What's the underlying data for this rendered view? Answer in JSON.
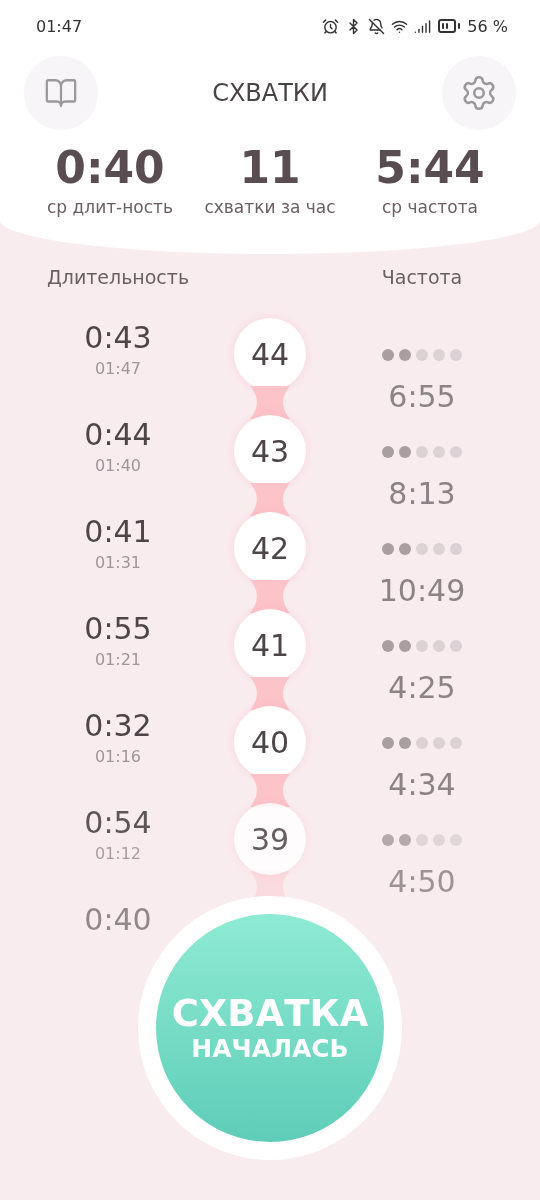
{
  "status_bar": {
    "time": "01:47",
    "battery": "56 %"
  },
  "header": {
    "title": "СХВАТКИ"
  },
  "stats": [
    {
      "value": "0:40",
      "label": "ср длит-ность"
    },
    {
      "value": "11",
      "label": "схватки за час"
    },
    {
      "value": "5:44",
      "label": "ср частота"
    }
  ],
  "columns": {
    "duration": "Длительность",
    "frequency": "Частота"
  },
  "contractions": [
    {
      "duration": "0:43",
      "start": "01:47",
      "number": "44",
      "stars": 2,
      "interval": "6:55"
    },
    {
      "duration": "0:44",
      "start": "01:40",
      "number": "43",
      "stars": 2,
      "interval": "8:13"
    },
    {
      "duration": "0:41",
      "start": "01:31",
      "number": "42",
      "stars": 2,
      "interval": "10:49"
    },
    {
      "duration": "0:55",
      "start": "01:21",
      "number": "41",
      "stars": 2,
      "interval": "4:25"
    },
    {
      "duration": "0:32",
      "start": "01:16",
      "number": "40",
      "stars": 2,
      "interval": "4:34"
    },
    {
      "duration": "0:54",
      "start": "01:12",
      "number": "39",
      "stars": 2,
      "interval": "4:50"
    },
    {
      "duration": "0:40"
    }
  ],
  "start_button": {
    "line_1": "СХВАТКА",
    "line_2": "НАЧАЛАСЬ"
  }
}
